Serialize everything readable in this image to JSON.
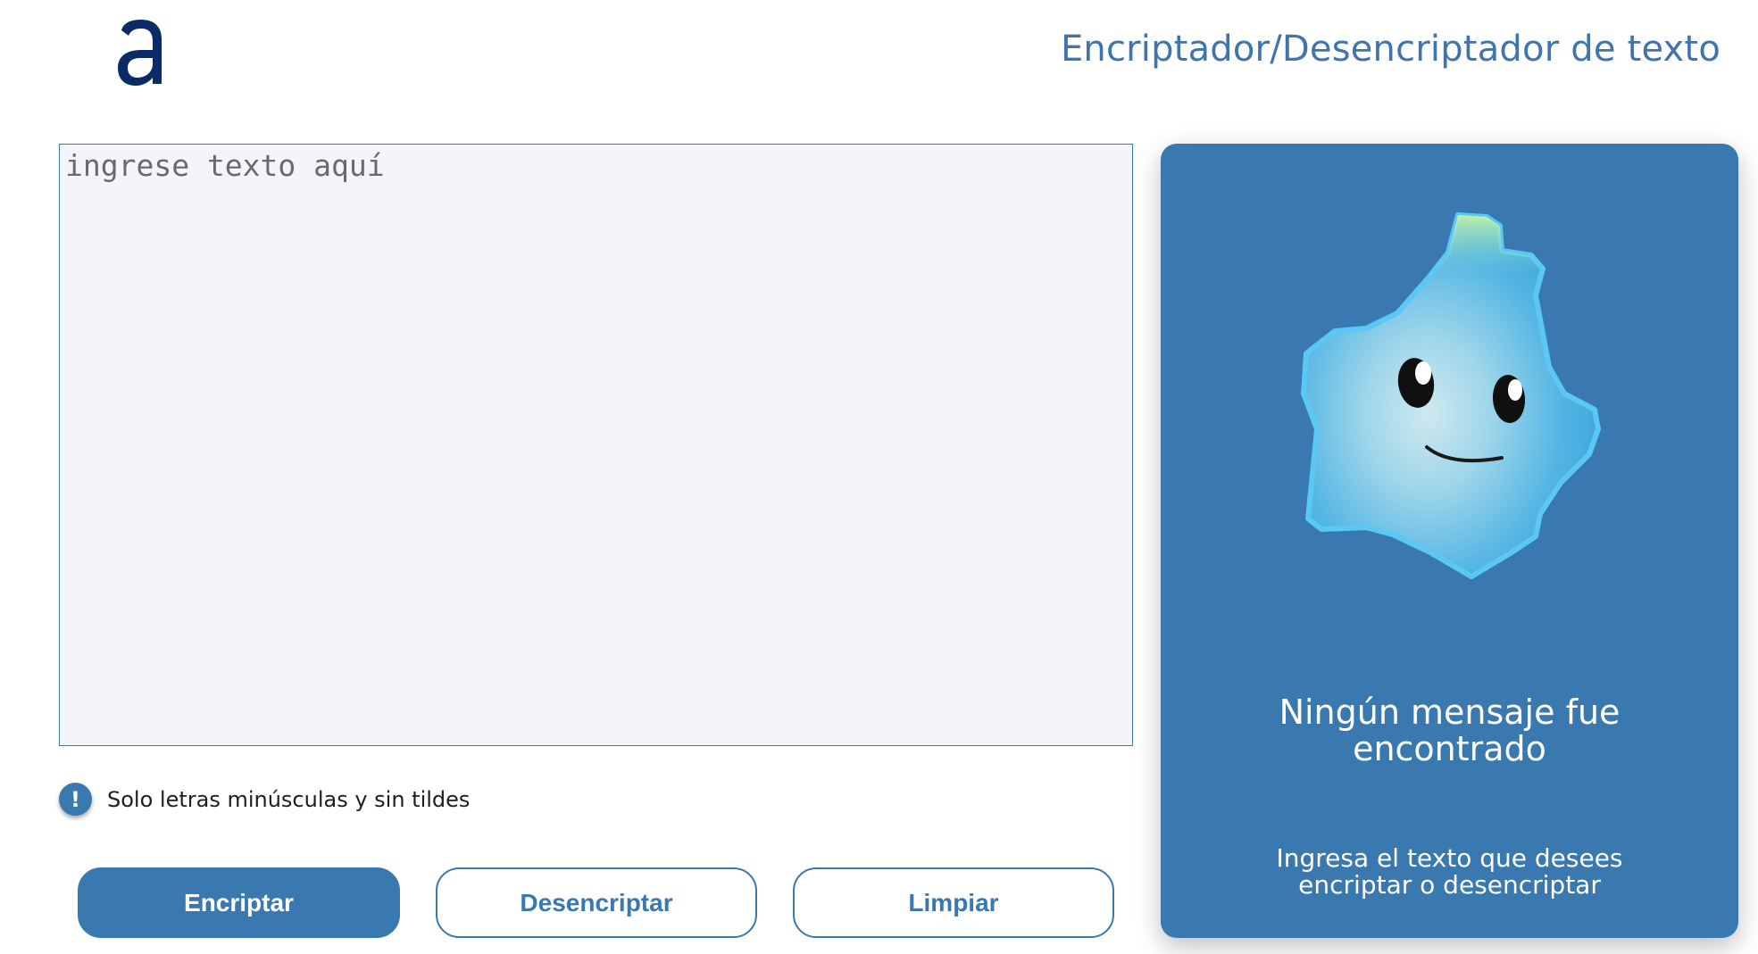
{
  "header": {
    "logo_icon": "alura-a-logo-icon",
    "title": "Encriptador/Desencriptador de texto"
  },
  "input": {
    "placeholder": "ingrese texto aquí",
    "value": ""
  },
  "hint": {
    "icon": "exclamation-circle-icon",
    "icon_glyph": "!",
    "text": "Solo letras minúsculas y sin tildes"
  },
  "buttons": {
    "encrypt_label": "Encriptar",
    "decrypt_label": "Desencriptar",
    "clear_label": "Limpiar"
  },
  "output": {
    "illustration": "smiling-star-mascot-icon",
    "title": "Ningún mensaje fue encontrado",
    "text": "Ingresa el texto que desees encriptar o desencriptar"
  },
  "colors": {
    "accent": "#3a78b0",
    "title": "#3f74ad",
    "logo": "#0b2b66",
    "input_bg": "#f3f5fa",
    "star": "#4eb3e6"
  }
}
